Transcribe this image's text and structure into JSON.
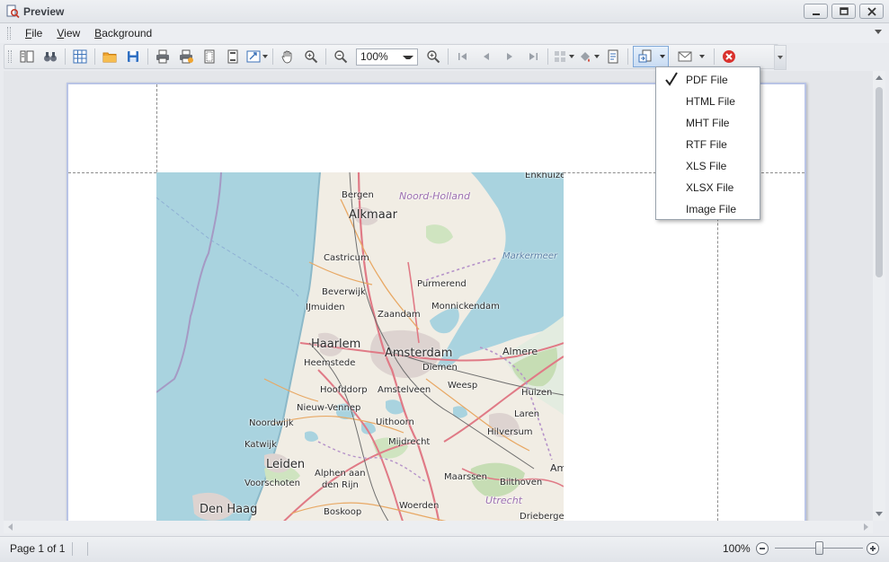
{
  "window": {
    "title": "Preview",
    "icon": "preview-app-icon",
    "buttons": [
      "minimize-icon",
      "maximize-icon",
      "close-icon"
    ]
  },
  "menubar": {
    "items": [
      {
        "label": "File",
        "underline": "F",
        "rest": "ile"
      },
      {
        "label": "View",
        "underline": "V",
        "rest": "iew"
      },
      {
        "label": "Background",
        "underline": "B",
        "rest": "ackground"
      }
    ]
  },
  "toolbar": {
    "zoom_value": "100%",
    "icons": [
      "document-map-icon",
      "search-binoculars-icon",
      "parameters-icon",
      "open-folder-icon",
      "save-icon",
      "print-icon",
      "quick-print-icon",
      "page-setup-icon",
      "header-footer-icon",
      "scale-icon",
      "hand-tool-icon",
      "magnifier-icon",
      "zoom-out-icon",
      "zoom-in-icon",
      "first-page-icon",
      "previous-page-icon",
      "next-page-icon",
      "last-page-icon",
      "multiple-pages-icon",
      "fill-background-icon",
      "watermark-icon",
      "export-icon",
      "send-email-icon",
      "close-preview-icon"
    ]
  },
  "export_menu": {
    "items": [
      {
        "label": "PDF File",
        "checked": true
      },
      {
        "label": "HTML File",
        "checked": false
      },
      {
        "label": "MHT File",
        "checked": false
      },
      {
        "label": "RTF File",
        "checked": false
      },
      {
        "label": "XLS File",
        "checked": false
      },
      {
        "label": "XLSX File",
        "checked": false
      },
      {
        "label": "Image File",
        "checked": false
      }
    ]
  },
  "map": {
    "labels": {
      "enkhuizen": "Enkhuize",
      "bergen": "Bergen",
      "noord_holland": "Noord-Holland",
      "alkmaar": "Alkmaar",
      "markermeer": "Markermeer",
      "castricum": "Castricum",
      "purmerend": "Purmerend",
      "beverwijk": "Beverwijk",
      "ijmuiden": "IJmuiden",
      "monnickendam": "Monnickendam",
      "zaandam": "Zaandam",
      "haarlem": "Haarlem",
      "amsterdam": "Amsterdam",
      "almere": "Almere",
      "heemstede": "Heemstede",
      "diemen": "Diemen",
      "weesp": "Weesp",
      "hoofddorp": "Hoofddorp",
      "amstelveen": "Amstelveen",
      "huizen": "Huizen",
      "nieuw_vennep": "Nieuw-Vennep",
      "laren": "Laren",
      "noordwijk": "Noordwijk",
      "uithoorn": "Uithoorn",
      "hilversum": "Hilversum",
      "katwijk": "Katwijk",
      "mijdrecht": "Mijdrecht",
      "leiden": "Leiden",
      "alphen": "Alphen aan",
      "alphen2": "den Rijn",
      "maarssen": "Maarssen",
      "bilthoven": "Bilthoven",
      "voorschoten": "Voorschoten",
      "den_haag": "Den Haag",
      "boskoop": "Boskoop",
      "woerden": "Woerden",
      "utrecht": "Utrecht",
      "driebergen": "Driebergen",
      "am": "Am"
    }
  },
  "status": {
    "page": "Page 1 of 1",
    "zoom": "100%",
    "zoom_level": 0.5
  }
}
